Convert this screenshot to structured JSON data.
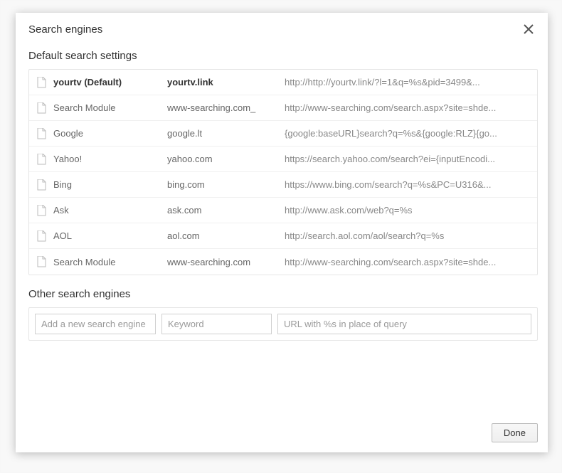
{
  "dialog": {
    "title": "Search engines",
    "default_section_title": "Default search settings",
    "other_section_title": "Other search engines",
    "done_label": "Done",
    "engines": [
      {
        "name": "yourtv (Default)",
        "keyword": "yourtv.link",
        "url": "http://http://yourtv.link/?l=1&q=%s&pid=3499&...",
        "default": true
      },
      {
        "name": "Search Module",
        "keyword": "www-searching.com_",
        "url": "http://www-searching.com/search.aspx?site=shde..."
      },
      {
        "name": "Google",
        "keyword": "google.lt",
        "url": "{google:baseURL}search?q=%s&{google:RLZ}{go..."
      },
      {
        "name": "Yahoo!",
        "keyword": "yahoo.com",
        "url": "https://search.yahoo.com/search?ei={inputEncodi..."
      },
      {
        "name": "Bing",
        "keyword": "bing.com",
        "url": "https://www.bing.com/search?q=%s&PC=U316&..."
      },
      {
        "name": "Ask",
        "keyword": "ask.com",
        "url": "http://www.ask.com/web?q=%s"
      },
      {
        "name": "AOL",
        "keyword": "aol.com",
        "url": "http://search.aol.com/aol/search?q=%s"
      },
      {
        "name": "Search Module",
        "keyword": "www-searching.com",
        "url": "http://www-searching.com/search.aspx?site=shde..."
      }
    ],
    "placeholders": {
      "name": "Add a new search engine",
      "keyword": "Keyword",
      "url": "URL with %s in place of query"
    }
  }
}
